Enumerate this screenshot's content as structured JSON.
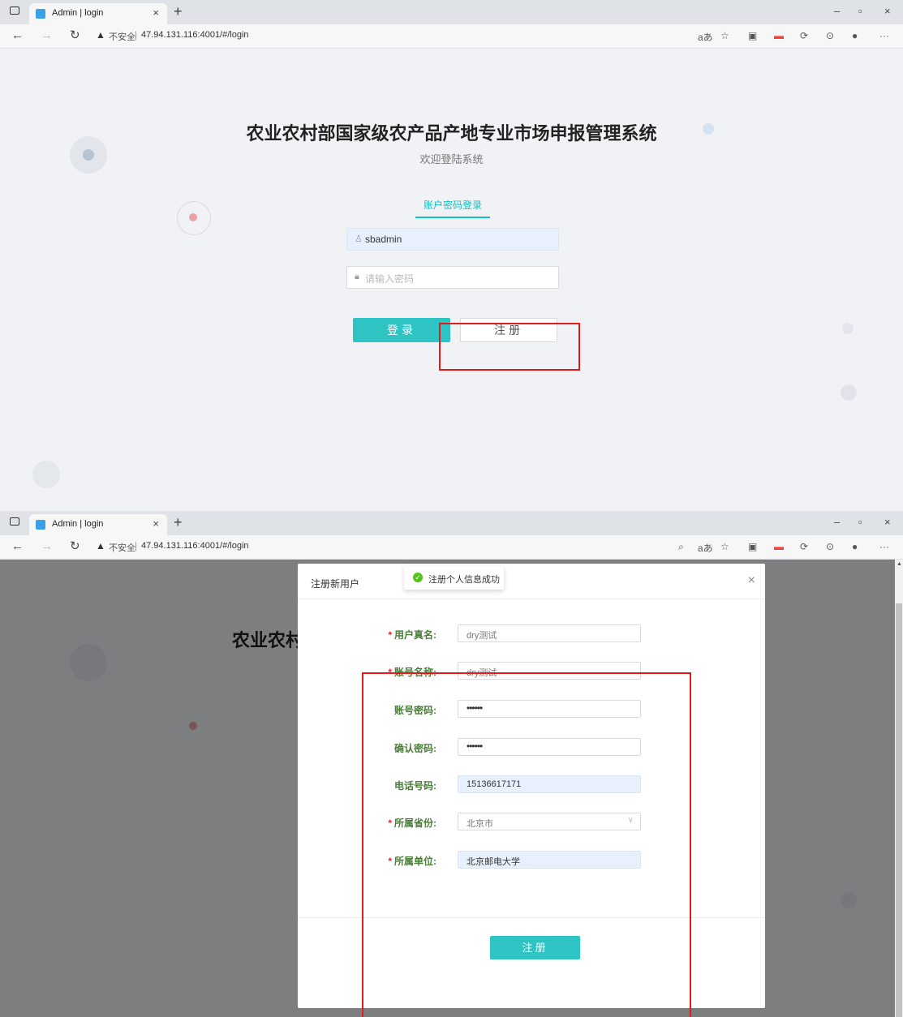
{
  "browser": {
    "tab_title": "Admin | login",
    "insecure_label": "不安全",
    "url": "47.94.131.116:4001/#/login"
  },
  "login": {
    "title": "农业农村部国家级农产品产地专业市场申报管理系统",
    "subtitle": "欢迎登陆系统",
    "tab_label": "账户密码登录",
    "username_value": "sbadmin",
    "password_placeholder": "请输入密码",
    "login_button": "登录",
    "register_button": "注册"
  },
  "background": {
    "title_partial": "农业农村"
  },
  "register_modal": {
    "title": "注册新用户",
    "toast": "注册个人信息成功",
    "fields": [
      {
        "label": "用户真名:",
        "value": "dry测试",
        "required": true
      },
      {
        "label": "账号名称:",
        "value": "dry测试",
        "required": true
      },
      {
        "label": "账号密码:",
        "value": "••••••",
        "required": false
      },
      {
        "label": "确认密码:",
        "value": "••••••",
        "required": false
      },
      {
        "label": "电话号码:",
        "value": "15136617171",
        "required": false
      },
      {
        "label": "所属省份:",
        "value": "北京市",
        "required": true
      },
      {
        "label": "所属单位:",
        "value": "北京邮电大学",
        "required": true
      }
    ],
    "submit_label": "注册"
  },
  "colors": {
    "accent": "#2ec4c4",
    "annotation_red": "#e21b1b",
    "success_green": "#52c41a",
    "label_green": "#4a7d3a"
  },
  "icons": [
    "sidebar-toggle-icon",
    "page-favicon-icon",
    "close-icon",
    "new-tab-icon",
    "back-icon",
    "forward-icon",
    "reload-icon",
    "warning-icon",
    "user-icon",
    "lock-icon",
    "check-circle-icon",
    "chevron-down-icon"
  ]
}
